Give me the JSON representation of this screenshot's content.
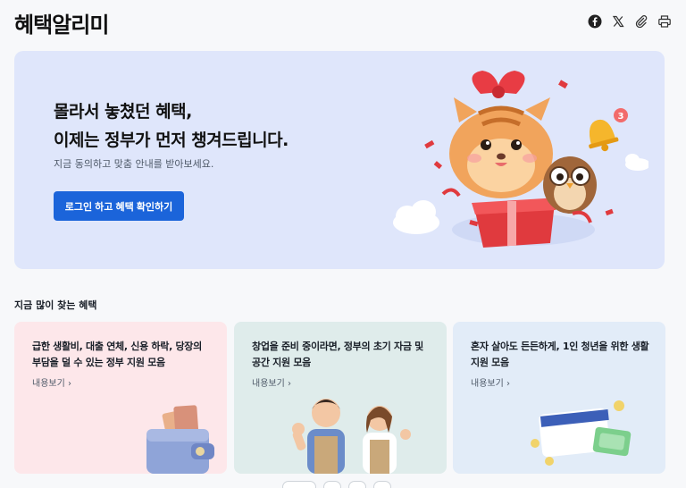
{
  "header": {
    "title": "혜택알리미",
    "icons": [
      "facebook-icon",
      "x-icon",
      "link-icon",
      "print-icon"
    ]
  },
  "hero": {
    "line1": "몰라서 놓쳤던 혜택,",
    "line2": "이제는 정부가 먼저 챙겨드립니다.",
    "subtitle": "지금 동의하고 맞춤 안내를 받아보세요.",
    "button_label": "로그인 하고 혜택 확인하기",
    "notification_badge": "3"
  },
  "section": {
    "title": "지금 많이 찾는 혜택"
  },
  "cards": [
    {
      "text": "급한 생활비, 대출 연체, 신용 하락, 당장의 부담을 덜 수 있는 정부 지원 모음",
      "more": "내용보기 ›"
    },
    {
      "text": "창업을 준비 중이라면, 정부의 초기 자금 및 공간 지원 모음",
      "more": "내용보기 ›"
    },
    {
      "text": "혼자 살아도 든든하게, 1인 청년을 위한 생활지원 모음",
      "more": "내용보기 ›"
    }
  ],
  "colors": {
    "accent": "#1b64da",
    "hero_bg": "#dfe6fb",
    "card1_bg": "#fde7ea",
    "card2_bg": "#dfeceb",
    "card3_bg": "#e2ecf8"
  }
}
